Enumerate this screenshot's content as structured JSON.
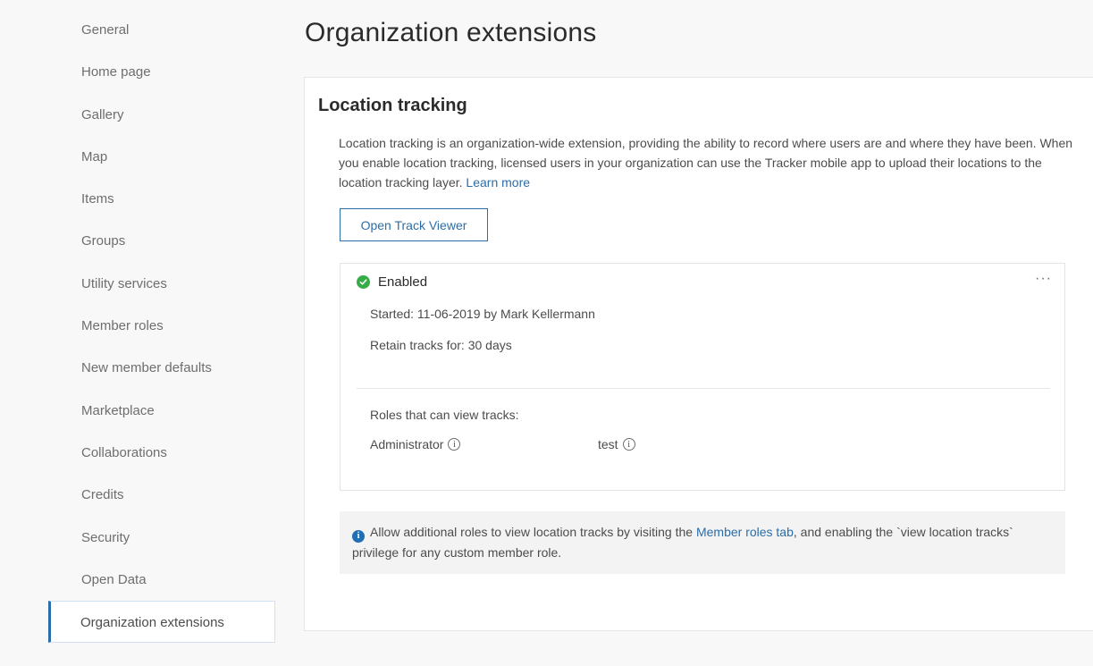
{
  "sidebar": {
    "items": [
      {
        "label": "General"
      },
      {
        "label": "Home page"
      },
      {
        "label": "Gallery"
      },
      {
        "label": "Map"
      },
      {
        "label": "Items"
      },
      {
        "label": "Groups"
      },
      {
        "label": "Utility services"
      },
      {
        "label": "Member roles"
      },
      {
        "label": "New member defaults"
      },
      {
        "label": "Marketplace"
      },
      {
        "label": "Collaborations"
      },
      {
        "label": "Credits"
      },
      {
        "label": "Security"
      },
      {
        "label": "Open Data"
      },
      {
        "label": "Organization extensions"
      }
    ],
    "active_index": 14
  },
  "main": {
    "title": "Organization extensions",
    "section": {
      "title": "Location tracking",
      "description": "Location tracking is an organization-wide extension, providing the ability to record where users are and where they have been. When you enable location tracking, licensed users in your organization can use the Tracker mobile app to upload their locations to the location tracking layer.",
      "learn_more": "Learn more",
      "open_button": "Open Track Viewer"
    },
    "status_card": {
      "status": "Enabled",
      "more_icon": "more-horizontal-icon",
      "started": "Started: 11-06-2019 by Mark Kellermann",
      "retain": "Retain tracks for:  30 days",
      "roles_label": "Roles that can view tracks:",
      "roles": [
        "Administrator",
        "test"
      ]
    },
    "notice": {
      "text_before": "Allow additional roles to view location tracks by visiting the ",
      "link": "Member roles tab",
      "text_after": ", and enabling the `view location tracks` privilege for any custom member role."
    }
  },
  "colors": {
    "accent": "#2b6da8",
    "success": "#35ac46",
    "info": "#1f6fb5"
  }
}
